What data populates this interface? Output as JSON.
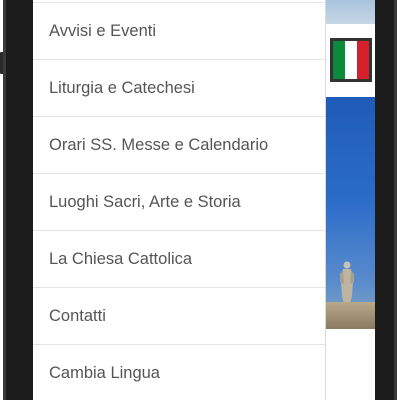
{
  "menu": {
    "items": [
      {
        "label": "Avvisi e Eventi"
      },
      {
        "label": "Liturgia e Catechesi"
      },
      {
        "label": "Orari SS. Messe e Calendario"
      },
      {
        "label": "Luoghi Sacri, Arte e Storia"
      },
      {
        "label": "La Chiesa Cattolica"
      },
      {
        "label": "Contatti"
      },
      {
        "label": "Cambia Lingua"
      }
    ]
  },
  "background": {
    "language_flag_icon": "italy-flag-icon",
    "statue_icon": "statue-icon"
  },
  "colors": {
    "menu_text": "#555555",
    "divider": "#e3e3e3",
    "phone_frame": "#1c1c1c",
    "flag_green": "#0a8a3a",
    "flag_red": "#d8202c",
    "sky_blue": "#1f5bb8"
  }
}
